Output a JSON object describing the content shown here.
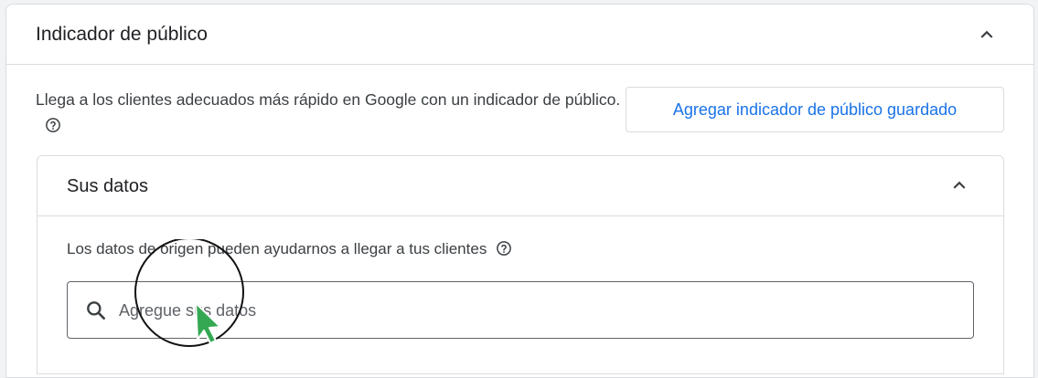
{
  "section": {
    "title": "Indicador de público",
    "collapse_icon": "chevron-up-icon",
    "description": "Llega a los clientes adecuados más rápido en Google con un indicador de público.",
    "help_icon": "help-circle-icon",
    "add_button_label": "Agregar indicador de público guardado"
  },
  "your_data": {
    "title": "Sus datos",
    "collapse_icon": "chevron-up-icon",
    "description": "Los datos de origen pueden ayudarnos a llegar a tus clientes",
    "help_icon": "help-circle-icon",
    "search": {
      "icon": "search-icon",
      "placeholder": "Agregue sus datos",
      "value": ""
    }
  },
  "pointer": {
    "icon": "cursor-arrow-icon",
    "color": "#34a853"
  },
  "colors": {
    "accent": "#1a73e8",
    "border": "#dadce0",
    "text": "#202124"
  }
}
